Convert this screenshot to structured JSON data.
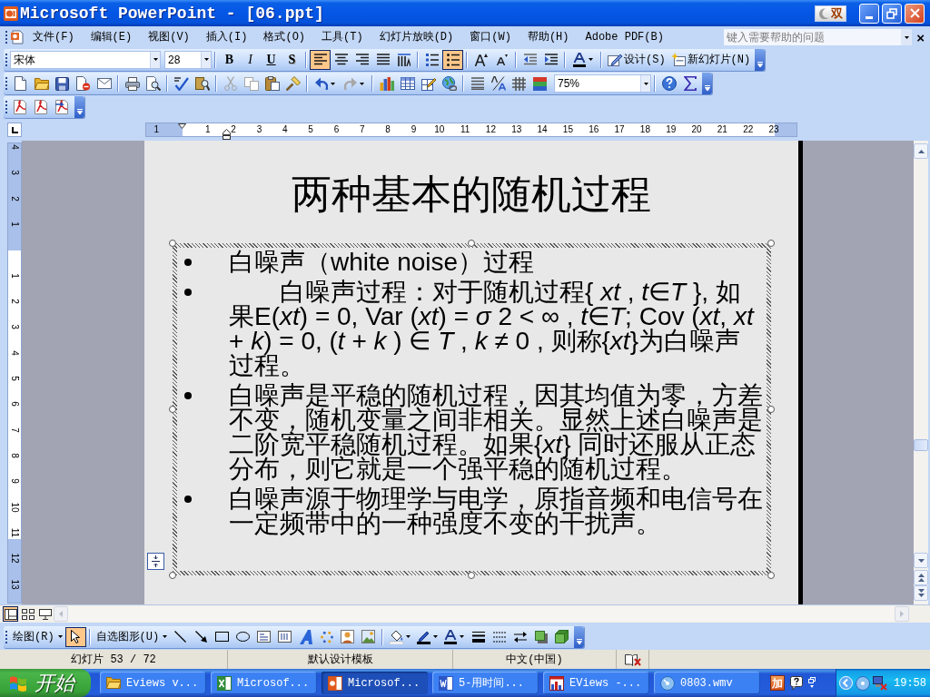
{
  "window": {
    "title": "Microsoft PowerPoint - [06.ppt]",
    "ime_indicator": "双"
  },
  "menu_bar": {
    "items": [
      "文件(F)",
      "编辑(E)",
      "视图(V)",
      "插入(I)",
      "格式(O)",
      "工具(T)",
      "幻灯片放映(D)",
      "窗口(W)",
      "帮助(H)",
      "Adobe PDF(B)"
    ],
    "help_search": {
      "placeholder": "键入需要帮助的问题"
    },
    "close_glyph": "×"
  },
  "formatting_toolbar": {
    "font": "宋体",
    "font_size": "28",
    "style_buttons": [
      "B",
      "I",
      "U",
      "S"
    ],
    "alignment": [
      {
        "selected": true
      },
      {
        "selected": false
      },
      {
        "selected": false
      },
      {
        "selected": false
      }
    ],
    "lists": [
      {
        "selected": false
      },
      {
        "selected": true
      }
    ],
    "design_button": "设计(S)",
    "new_slide_button": "新幻灯片(N)"
  },
  "standard_toolbar": {
    "edit_buttons": [
      {
        "disabled": true
      },
      {
        "disabled": true
      },
      {
        "disabled": false
      },
      {
        "disabled": false
      }
    ],
    "history_buttons": [
      {
        "disabled": false
      },
      {
        "disabled": true
      }
    ],
    "zoom": "75%"
  },
  "horizontal_ruler": {
    "left_labels": [
      "1"
    ],
    "right_labels": [
      "1",
      "2",
      "3",
      "4",
      "5",
      "6",
      "7",
      "8",
      "9",
      "10",
      "11",
      "12",
      "13",
      "14",
      "15",
      "16",
      "17",
      "18",
      "19",
      "20",
      "21",
      "22",
      "23"
    ]
  },
  "vertical_ruler": {
    "top_labels": [
      "4",
      "3",
      "2",
      "1"
    ],
    "bottom_labels": [
      "1",
      "2",
      "3",
      "4",
      "5",
      "6",
      "7",
      "8",
      "9",
      "10",
      "11",
      "12",
      "13"
    ]
  },
  "slide": {
    "title": "两种基本的随机过程",
    "bullets": [
      "白噪声（white noise）过程",
      "　　白噪声过程：对于随机过程{ *xt* , *t*∈*T* }, 如果E(*xt*) = 0, Var (*xt*) = *σ* 2 < ∞ , *t*∈*T*; Cov (*xt*, *xt* + *k*) = 0, (*t* + *k* ) ∈ *T* , *k* ≠ 0 , 则称{*xt*}为白噪声过程。",
      "白噪声是平稳的随机过程，因其均值为零，方差不变，随机变量之间非相关。显然上述白噪声是二阶宽平稳随机过程。如果{*xt*} 同时还服从正态分布，则它就是一个强平稳的随机过程。",
      "白噪声源于物理学与电学，原指音频和电信号在一定频带中的一种强度不变的干扰声。"
    ]
  },
  "view_buttons": [
    {
      "selected": true
    },
    {
      "selected": false
    },
    {
      "selected": false
    }
  ],
  "drawing_toolbar": {
    "draw_menu": "绘图(R)",
    "select_tool": {
      "selected": true
    },
    "autoshapes_menu": "自选图形(U)"
  },
  "status_bar": {
    "slide_counter": "幻灯片 53 / 72",
    "design": "默认设计模板",
    "language": "中文(中国)"
  },
  "taskbar": {
    "start": "开始",
    "tasks": [
      {
        "label": "Eviews v...",
        "kind": "folder",
        "selected": false
      },
      {
        "label": "Microsof...",
        "kind": "spreadsheet",
        "selected": false
      },
      {
        "label": "Microsof...",
        "kind": "presentation",
        "selected": true
      },
      {
        "label": "5-用时间...",
        "kind": "document",
        "selected": false
      },
      {
        "label": "EViews -...",
        "kind": "chart",
        "selected": false
      },
      {
        "label": "0803.wmv",
        "kind": "media",
        "selected": false
      }
    ],
    "tray_badge": "加",
    "clock": "19:58"
  }
}
